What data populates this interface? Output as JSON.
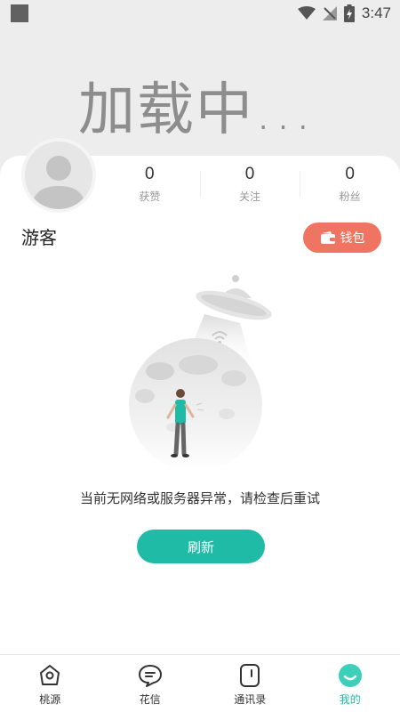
{
  "status_bar": {
    "time": "3:47"
  },
  "header": {
    "loading_text": "加载中..."
  },
  "profile": {
    "username": "游客",
    "stats": [
      {
        "value": "0",
        "label": "获赞"
      },
      {
        "value": "0",
        "label": "关注"
      },
      {
        "value": "0",
        "label": "粉丝"
      }
    ],
    "wallet_label": "钱包"
  },
  "error": {
    "message": "当前无网络或服务器异常，请检查后重试",
    "refresh_label": "刷新"
  },
  "bottom_nav": {
    "items": [
      {
        "label": "桃源",
        "icon": "location-icon"
      },
      {
        "label": "花信",
        "icon": "message-icon"
      },
      {
        "label": "通讯录",
        "icon": "contacts-icon"
      },
      {
        "label": "我的",
        "icon": "smile-icon",
        "active": true
      }
    ]
  },
  "colors": {
    "accent": "#1fbba6",
    "wallet": "#ef7461",
    "background": "#ededed"
  }
}
